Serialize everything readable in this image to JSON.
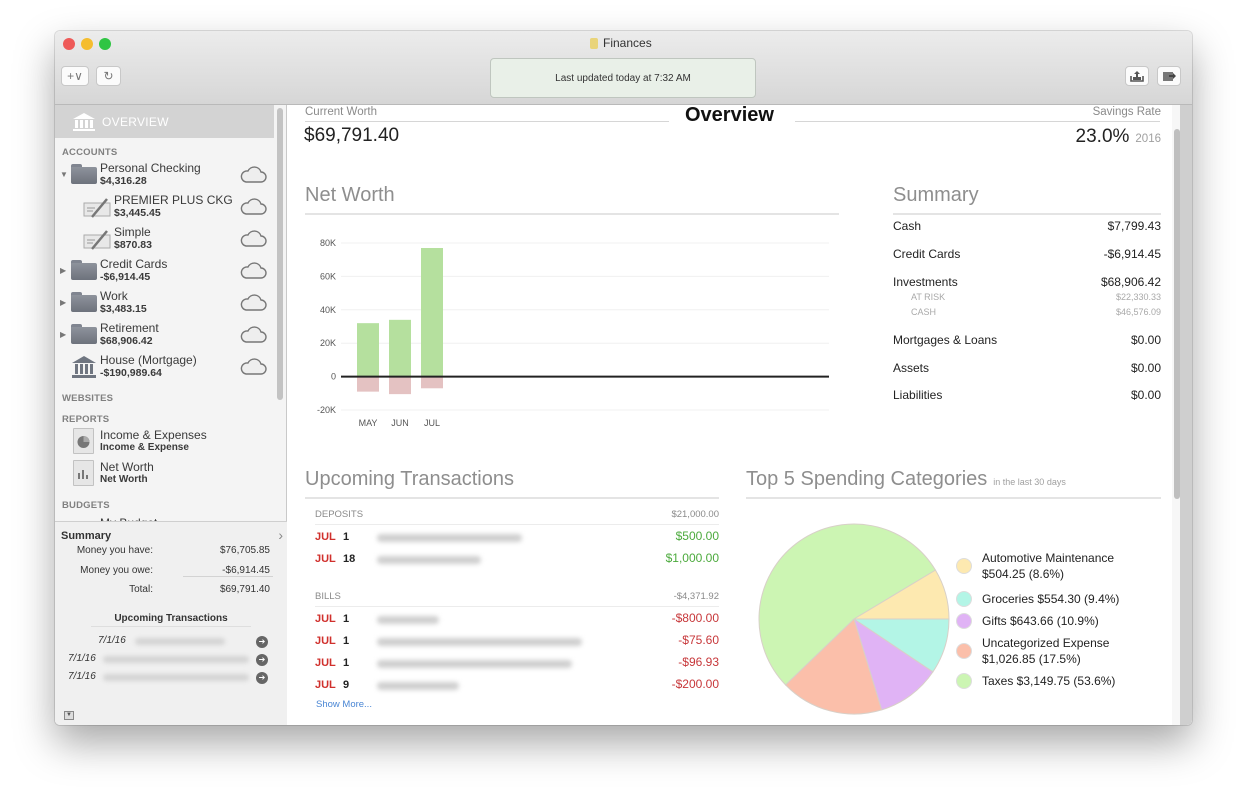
{
  "window": {
    "title": "Finances",
    "status": "Last updated today at 7:32 AM"
  },
  "toolbar": {
    "add_label": "+∨",
    "refresh_icon": "↻",
    "export_icon": "export-tray-icon",
    "share_icon": "share-arrow-icon"
  },
  "sidebar": {
    "overview_label": "OVERVIEW",
    "accounts_header": "ACCOUNTS",
    "accounts": [
      {
        "name": "Personal Checking",
        "balance": "$4,316.28",
        "icon": "folder-icon",
        "expanded": true
      },
      {
        "name": "PREMIER PLUS CKG",
        "balance": "$3,445.45",
        "icon": "check-icon",
        "child": true
      },
      {
        "name": "Simple",
        "balance": "$870.83",
        "icon": "check-icon",
        "child": true
      },
      {
        "name": "Credit Cards",
        "balance": "-$6,914.45",
        "icon": "folder-icon",
        "expanded": false
      },
      {
        "name": "Work",
        "balance": "$3,483.15",
        "icon": "folder-icon",
        "expanded": false
      },
      {
        "name": "Retirement",
        "balance": "$68,906.42",
        "icon": "folder-icon",
        "expanded": false
      },
      {
        "name": "House (Mortgage)",
        "balance": "-$190,989.64",
        "icon": "bank-icon"
      }
    ],
    "websites_header": "WEBSITES",
    "reports_header": "REPORTS",
    "reports": [
      {
        "name": "Income & Expenses",
        "sub": "Income & Expense"
      },
      {
        "name": "Net Worth",
        "sub": "Net Worth"
      }
    ],
    "budgets_header": "BUDGETS",
    "budget_item": "My Budget",
    "summary": {
      "title": "Summary",
      "rows": [
        {
          "label": "Money you have:",
          "value": "$76,705.85"
        },
        {
          "label": "Money you owe:",
          "value": "-$6,914.45"
        },
        {
          "label": "Total:",
          "value": "$69,791.40"
        }
      ],
      "upcoming_title": "Upcoming Transactions",
      "upcoming": [
        {
          "date": "7/1/16"
        },
        {
          "date": "7/1/16"
        },
        {
          "date": "7/1/16"
        }
      ]
    }
  },
  "main": {
    "current_worth_label": "Current Worth",
    "current_worth": "$69,791.40",
    "title": "Overview",
    "savings_rate_label": "Savings Rate",
    "savings_rate": "23.0%",
    "savings_year": "2016",
    "net_worth_title": "Net Worth",
    "summary": {
      "title": "Summary",
      "rows": [
        {
          "label": "Cash",
          "value": "$7,799.43"
        },
        {
          "label": "Credit Cards",
          "value": "-$6,914.45"
        },
        {
          "label": "Investments",
          "value": "$68,906.42"
        },
        {
          "label": "Mortgages & Loans",
          "value": "$0.00"
        },
        {
          "label": "Assets",
          "value": "$0.00"
        },
        {
          "label": "Liabilities",
          "value": "$0.00"
        }
      ],
      "investment_subs": [
        {
          "label": "AT RISK",
          "value": "$22,330.33"
        },
        {
          "label": "CASH",
          "value": "$46,576.09"
        }
      ]
    },
    "upcoming": {
      "title": "Upcoming Transactions",
      "deposits_label": "DEPOSITS",
      "deposits_total": "$21,000.00",
      "deposits": [
        {
          "month": "JUL",
          "day": "1",
          "amount": "$500.00"
        },
        {
          "month": "JUL",
          "day": "18",
          "amount": "$1,000.00"
        }
      ],
      "bills_label": "BILLS",
      "bills_total": "-$4,371.92",
      "bills": [
        {
          "month": "JUL",
          "day": "1",
          "amount": "-$800.00"
        },
        {
          "month": "JUL",
          "day": "1",
          "amount": "-$75.60"
        },
        {
          "month": "JUL",
          "day": "1",
          "amount": "-$96.93"
        },
        {
          "month": "JUL",
          "day": "9",
          "amount": "-$200.00"
        }
      ],
      "show_more": "Show More..."
    },
    "spending": {
      "title": "Top 5 Spending Categories",
      "subtitle": "in the last 30 days"
    }
  },
  "chart_data": [
    {
      "type": "bar",
      "title": "Net Worth",
      "categories": [
        "MAY",
        "JUN",
        "JUL"
      ],
      "series": [
        {
          "name": "Assets",
          "values": [
            32000,
            34000,
            77000
          ],
          "color": "#b5e09e"
        },
        {
          "name": "Liabilities",
          "values": [
            -9000,
            -10500,
            -7000
          ],
          "color": "#e4c2c2"
        }
      ],
      "yticks": [
        "80K",
        "60K",
        "40K",
        "20K",
        "0",
        "-20K"
      ],
      "ylim": [
        -20000,
        80000
      ],
      "grid": true
    },
    {
      "type": "pie",
      "title": "Top 5 Spending Categories",
      "slices": [
        {
          "label": "Automotive Maintenance",
          "amount": "$504.25",
          "percent": 8.6,
          "color": "#fde9b0"
        },
        {
          "label": "Groceries",
          "amount": "$554.30",
          "percent": 9.4,
          "color": "#b3f5e6"
        },
        {
          "label": "Gifts",
          "amount": "$643.66",
          "percent": 10.9,
          "color": "#e0b3f5"
        },
        {
          "label": "Uncategorized Expense",
          "amount": "$1,026.85",
          "percent": 17.5,
          "color": "#fbbfaa"
        },
        {
          "label": "Taxes",
          "amount": "$3,149.75",
          "percent": 53.6,
          "color": "#ccf5b3"
        }
      ],
      "legend_labels": [
        [
          "Automotive Maintenance",
          "$504.25 (8.6%)"
        ],
        [
          "Groceries $554.30 (9.4%)"
        ],
        [
          "Gifts $643.66 (10.9%)"
        ],
        [
          "Uncategorized Expense",
          "$1,026.85 (17.5%)"
        ],
        [
          "Taxes $3,149.75 (53.6%)"
        ]
      ]
    }
  ]
}
